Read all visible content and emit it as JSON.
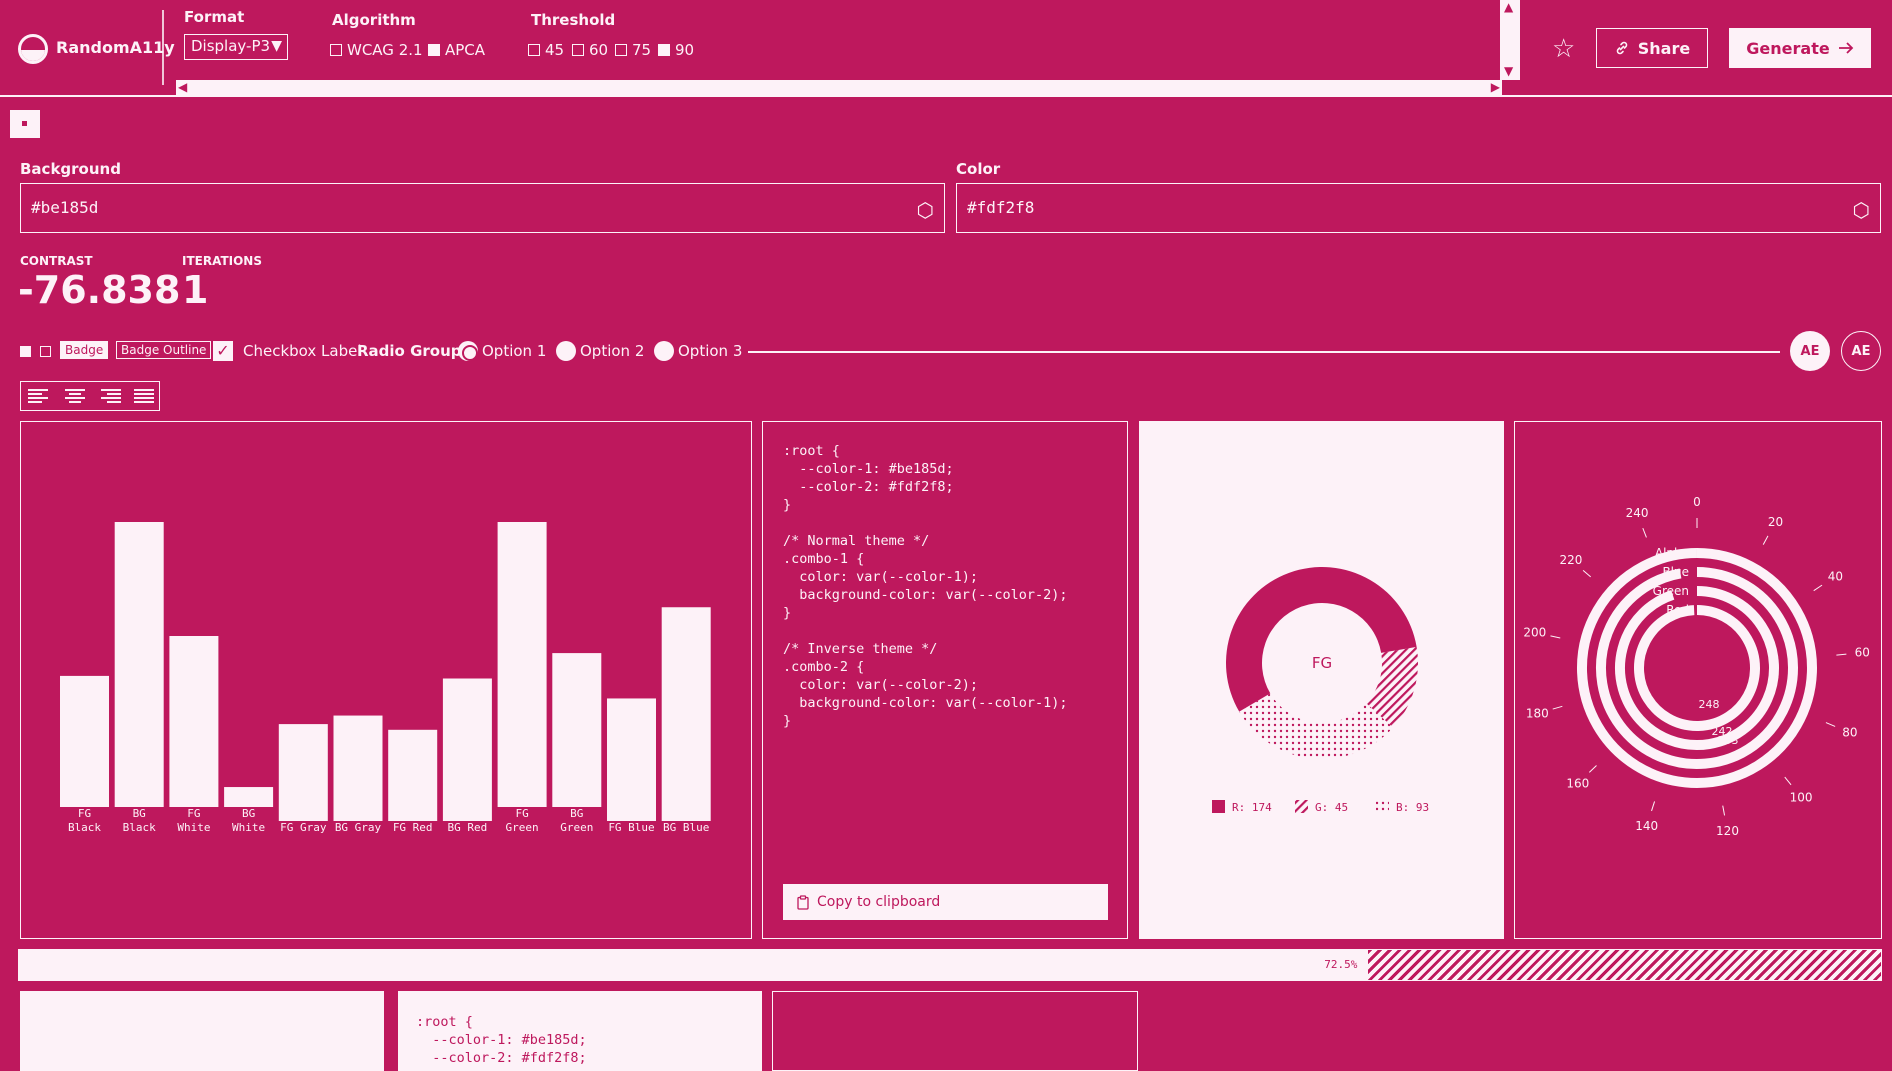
{
  "app": {
    "name": "RandomA11y"
  },
  "header": {
    "format": {
      "label": "Format",
      "selected": "Display-P3"
    },
    "algorithm": {
      "label": "Algorithm",
      "options": [
        {
          "label": "WCAG 2.1",
          "checked": false
        },
        {
          "label": "APCA",
          "checked": true
        }
      ]
    },
    "threshold": {
      "label": "Threshold",
      "options": [
        {
          "label": "45",
          "checked": false
        },
        {
          "label": "60",
          "checked": false
        },
        {
          "label": "75",
          "checked": false
        },
        {
          "label": "90",
          "checked": true
        }
      ]
    },
    "share_label": "Share",
    "generate_label": "Generate"
  },
  "colors": {
    "background": "#be185d",
    "foreground": "#fdf2f8"
  },
  "inputs": {
    "background": {
      "label": "Background",
      "value": "#be185d"
    },
    "color": {
      "label": "Color",
      "value": "#fdf2f8"
    }
  },
  "stats": {
    "contrast_label": "CONTRAST",
    "contrast_value": "-76.838",
    "iterations_label": "ITERATIONS",
    "iterations_value": "1"
  },
  "components": {
    "badge": "Badge",
    "badge_outline": "Badge Outline",
    "checkbox_label": "Checkbox Label",
    "radio_group_label": "Radio Group",
    "radio_options": [
      "Option 1",
      "Option 2",
      "Option 3"
    ],
    "avatar_initials": "AE"
  },
  "code": {
    "text": ":root {\n  --color-1: #be185d;\n  --color-2: #fdf2f8;\n}\n\n/* Normal theme */\n.combo-1 {\n  color: var(--color-1);\n  background-color: var(--color-2);\n}\n\n/* Inverse theme */\n.combo-2 {\n  color: var(--color-2);\n  background-color: var(--color-1);\n}",
    "copy_label": "Copy to clipboard",
    "bottom_text": ":root {\n  --color-1: #be185d;\n  --color-2: #fdf2f8;"
  },
  "progress": {
    "value": 72.5,
    "label": "72.5%"
  },
  "chart_data": [
    {
      "type": "bar",
      "categories": [
        "FG Black",
        "BG Black",
        "FG White",
        "BG White",
        "FG Gray",
        "BG Gray",
        "FG Red",
        "BG Red",
        "FG Green",
        "BG Green",
        "FG Blue",
        "BG Blue"
      ],
      "category_lines": [
        [
          "FG",
          "Black"
        ],
        [
          "BG",
          "Black"
        ],
        [
          "FG",
          "White"
        ],
        [
          "BG",
          "White"
        ],
        [
          "FG Gray"
        ],
        [
          "BG Gray"
        ],
        [
          "FG Red"
        ],
        [
          "BG Red"
        ],
        [
          "FG",
          "Green"
        ],
        [
          "BG",
          "Green"
        ],
        [
          "FG Blue"
        ],
        [
          "BG Blue"
        ]
      ],
      "values": [
        46,
        100,
        60,
        7,
        34,
        37,
        32,
        50,
        100,
        54,
        43,
        75
      ]
    },
    {
      "type": "pie",
      "center_label": "FG",
      "series": [
        {
          "name": "R",
          "value": 174,
          "label": "R: 174",
          "pattern": "solid"
        },
        {
          "name": "G",
          "value": 45,
          "label": "G: 45",
          "pattern": "hatch"
        },
        {
          "name": "B",
          "value": 93,
          "label": "B: 93",
          "pattern": "dots"
        }
      ]
    },
    {
      "type": "radial-bar",
      "angle_ticks": [
        0,
        20,
        40,
        60,
        80,
        100,
        120,
        140,
        160,
        180,
        200,
        220,
        240
      ],
      "max": 255,
      "series": [
        {
          "name": "Alpha",
          "value": 255
        },
        {
          "name": "Blue",
          "value": 248
        },
        {
          "name": "Green",
          "value": 242
        },
        {
          "name": "Red",
          "value": 253
        }
      ],
      "inner_labels": [
        "248",
        "242",
        "253"
      ]
    }
  ]
}
